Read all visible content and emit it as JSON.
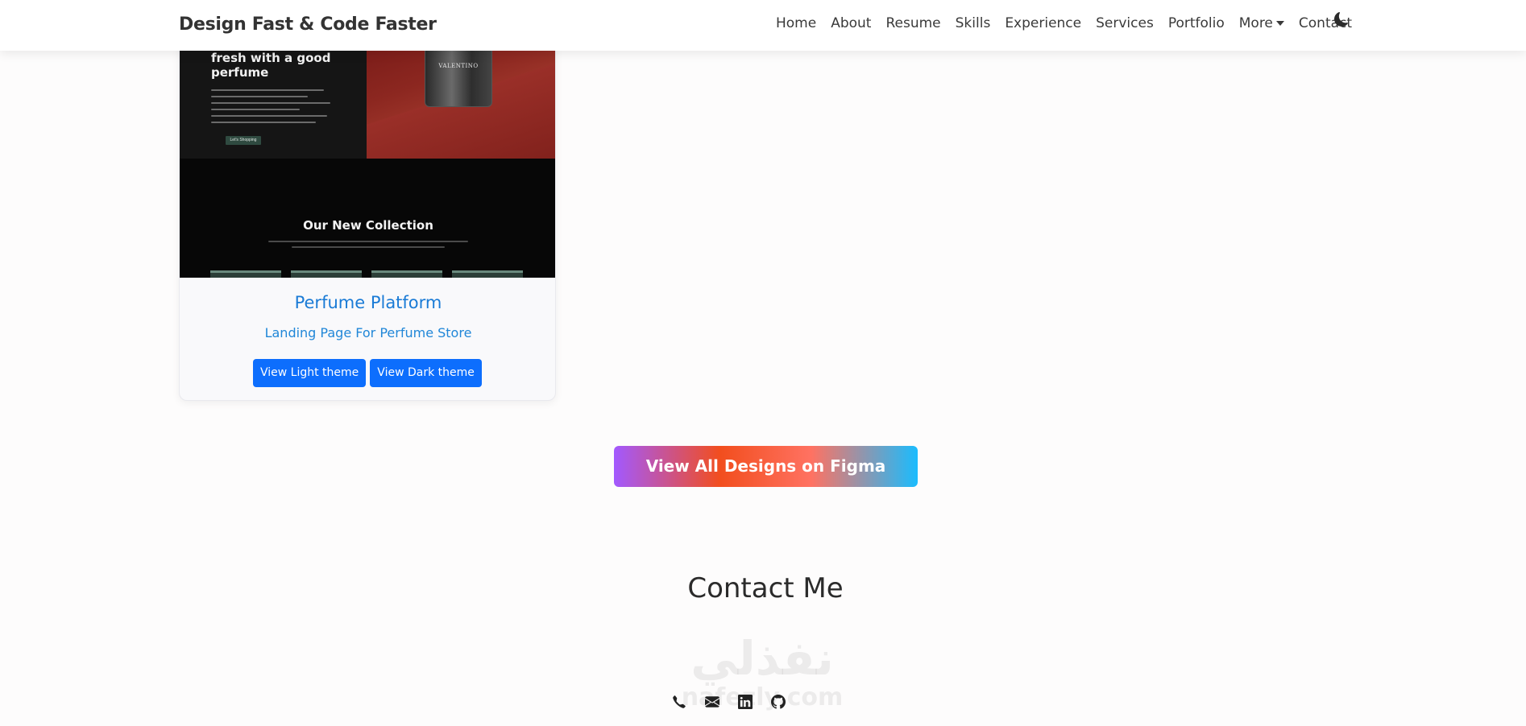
{
  "navbar": {
    "brand": "Design Fast & Code Faster",
    "links": [
      {
        "label": "Home"
      },
      {
        "label": "About"
      },
      {
        "label": "Resume"
      },
      {
        "label": "Skills"
      },
      {
        "label": "Experience"
      },
      {
        "label": "Services"
      },
      {
        "label": "Portfolio"
      },
      {
        "label": "More"
      },
      {
        "label": "Contact"
      }
    ],
    "theme_toggle_icon": "moon-icon"
  },
  "portfolio_card": {
    "preview": {
      "hero_title": "fresh with a good perfume",
      "hero_button": "Let's Shopping",
      "bottle_label": "VALENTINO",
      "collection_title": "Our New Collection"
    },
    "title": "Perfume Platform",
    "subtitle": "Landing Page For Perfume Store",
    "buttons": {
      "light": "View Light theme",
      "dark": "View Dark theme"
    }
  },
  "figma_button": {
    "label": "View All Designs on Figma"
  },
  "contact": {
    "title": "Contact Me",
    "icons": [
      "phone-icon",
      "email-icon",
      "linkedin-icon",
      "github-icon"
    ]
  },
  "watermark": {
    "arabic": "نفذلي",
    "latin": "nafezly.com"
  },
  "colors": {
    "primary": "#0d6efd",
    "card_title": "#1a7bd6",
    "gradient": [
      "#a259ff",
      "#f24e1e",
      "#ff7262",
      "#1abcfe"
    ]
  }
}
